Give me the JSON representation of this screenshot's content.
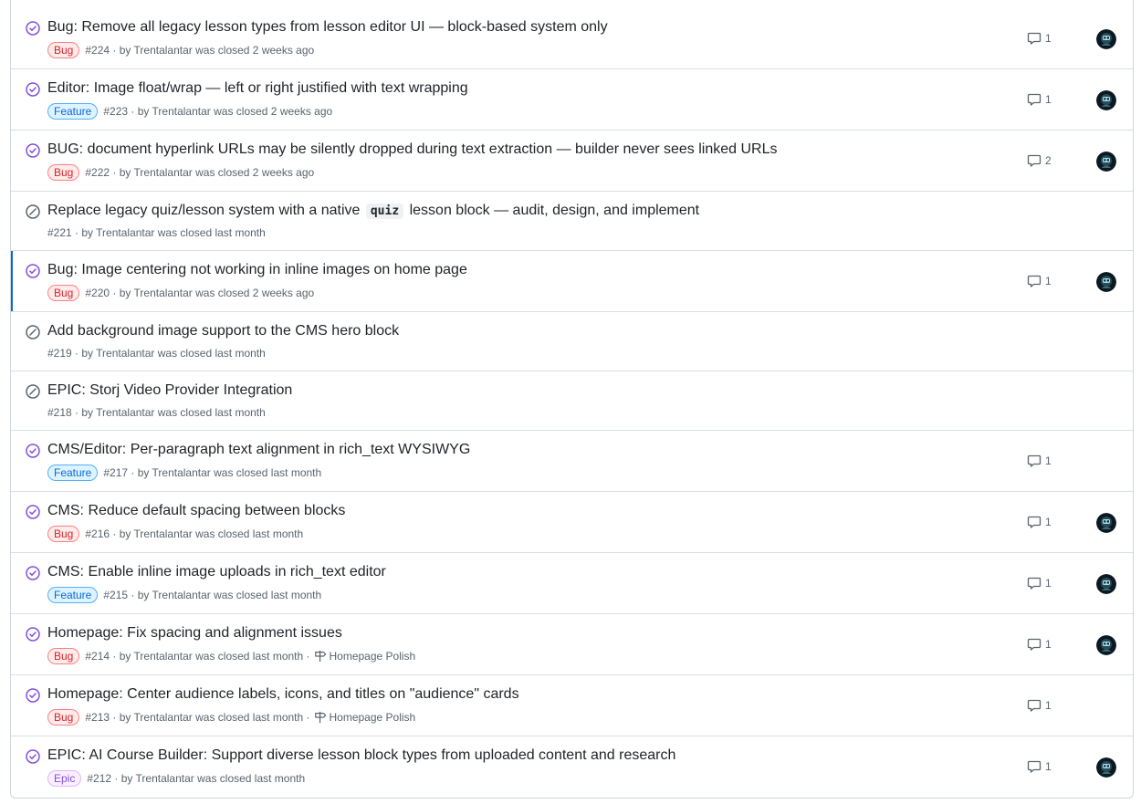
{
  "issues": [
    {
      "title": "Bug: Remove all legacy lesson types from lesson editor UI — block-based system only",
      "label": "Bug",
      "number": "#224",
      "meta": "· by Trentalantar was closed 2 weeks ago",
      "milestone": "",
      "comments": "1",
      "avatar": true,
      "state": "completed"
    },
    {
      "title": "Editor: Image float/wrap — left or right justified with text wrapping",
      "label": "Feature",
      "number": "#223",
      "meta": "· by Trentalantar was closed 2 weeks ago",
      "milestone": "",
      "comments": "1",
      "avatar": true,
      "state": "completed"
    },
    {
      "title": "BUG: document hyperlink URLs may be silently dropped during text extraction — builder never sees linked URLs",
      "label": "Bug",
      "number": "#222",
      "meta": "· by Trentalantar was closed 2 weeks ago",
      "milestone": "",
      "comments": "2",
      "avatar": true,
      "state": "completed"
    },
    {
      "title_pre": "Replace legacy quiz/lesson system with a native",
      "title_code": "quiz",
      "title_post": "lesson block — audit, design, and implement",
      "label": "",
      "number": "#221",
      "meta": "· by Trentalantar was closed last month",
      "milestone": "",
      "comments": "",
      "avatar": false,
      "state": "not-planned"
    },
    {
      "title": "Bug: Image centering not working in inline images on home page",
      "label": "Bug",
      "number": "#220",
      "meta": "· by Trentalantar was closed 2 weeks ago",
      "milestone": "",
      "comments": "1",
      "avatar": true,
      "state": "completed"
    },
    {
      "title": "Add background image support to the CMS hero block",
      "label": "",
      "number": "#219",
      "meta": "· by Trentalantar was closed last month",
      "milestone": "",
      "comments": "",
      "avatar": false,
      "state": "not-planned"
    },
    {
      "title": "EPIC: Storj Video Provider Integration",
      "label": "",
      "number": "#218",
      "meta": "· by Trentalantar was closed last month",
      "milestone": "",
      "comments": "",
      "avatar": false,
      "state": "not-planned"
    },
    {
      "title": "CMS/Editor: Per-paragraph text alignment in rich_text WYSIWYG",
      "label": "Feature",
      "number": "#217",
      "meta": "· by Trentalantar was closed last month",
      "milestone": "",
      "comments": "1",
      "avatar": false,
      "state": "completed"
    },
    {
      "title": "CMS: Reduce default spacing between blocks",
      "label": "Bug",
      "number": "#216",
      "meta": "· by Trentalantar was closed last month",
      "milestone": "",
      "comments": "1",
      "avatar": true,
      "state": "completed"
    },
    {
      "title": "CMS: Enable inline image uploads in rich_text editor",
      "label": "Feature",
      "number": "#215",
      "meta": "· by Trentalantar was closed last month",
      "milestone": "",
      "comments": "1",
      "avatar": true,
      "state": "completed"
    },
    {
      "title": "Homepage: Fix spacing and alignment issues",
      "label": "Bug",
      "number": "#214",
      "meta": "· by Trentalantar was closed last month ·",
      "milestone": "Homepage Polish",
      "comments": "1",
      "avatar": true,
      "state": "completed"
    },
    {
      "title": "Homepage: Center audience labels, icons, and titles on \"audience\" cards",
      "label": "Bug",
      "number": "#213",
      "meta": "· by Trentalantar was closed last month ·",
      "milestone": "Homepage Polish",
      "comments": "1",
      "avatar": false,
      "state": "completed"
    },
    {
      "title": "EPIC: AI Course Builder: Support diverse lesson block types from uploaded content and research",
      "label": "Epic",
      "number": "#212",
      "meta": "· by Trentalantar was closed last month",
      "milestone": "",
      "comments": "1",
      "avatar": true,
      "state": "completed"
    }
  ],
  "labels": {
    "Bug": {
      "bg": "#ffebe9",
      "border": "#ff8182",
      "color": "#d1242f"
    },
    "Feature": {
      "bg": "#ddf4ff",
      "border": "#54aeff",
      "color": "#0969da"
    },
    "Epic": {
      "bg": "#fbefff",
      "border": "#d8b9ff",
      "color": "#8250df"
    }
  },
  "colors": {
    "completed": "#8250df",
    "not_planned": "#59636e",
    "selected_bar": "#0969da"
  },
  "icons": {
    "completed": "check-circle-icon",
    "not_planned": "skip-circle-icon",
    "comment": "comment-icon",
    "milestone": "milestone-icon"
  }
}
